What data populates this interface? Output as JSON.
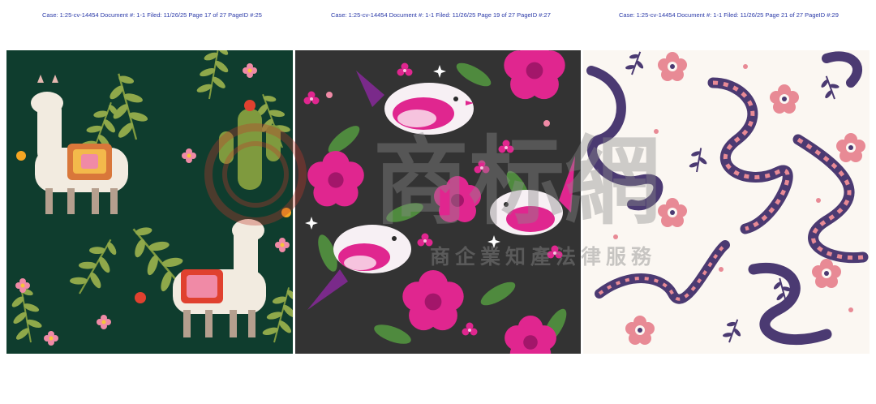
{
  "headers": [
    "Case: 1:25-cv-14454 Document #: 1-1 Filed: 11/26/25 Page 17 of 27 PageID #:25",
    "Case: 1:25-cv-14454 Document #: 1-1 Filed: 11/26/25 Page 19 of 27 PageID #:27",
    "Case: 1:25-cv-14454 Document #: 1-1 Filed: 11/26/25 Page 21 of 27 PageID #:29"
  ],
  "panels": [
    {
      "subject": "llama-cactus-pattern",
      "background": "#0f3d2e"
    },
    {
      "subject": "bird-flower-pattern",
      "background": "#333333"
    },
    {
      "subject": "snake-pattern",
      "background": "#fbf7f2"
    }
  ],
  "colors": {
    "header_text": "#2b3aa8",
    "pink": "#e0268f",
    "snake_purple": "#4b3a72",
    "snake_pink": "#e88a95",
    "leaf_green": "#7f9a3e"
  },
  "watermark": {
    "main": "商标網",
    "sub": "商企業知產法律服務"
  }
}
